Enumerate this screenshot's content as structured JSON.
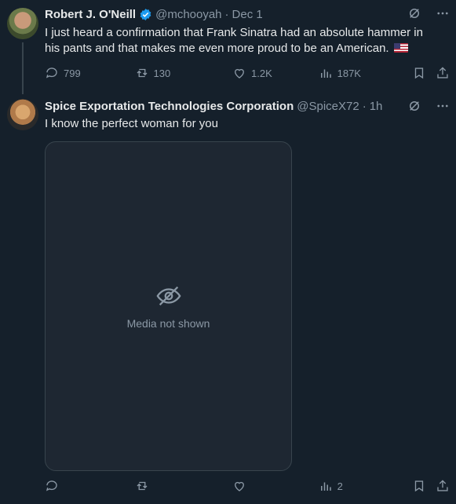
{
  "tweet1": {
    "name": "Robert J. O'Neill",
    "handle": "@mchooyah",
    "dot": "·",
    "time": "Dec 1",
    "text": "I just heard a confirmation that Frank Sinatra had an absolute hammer in his pants and that makes me even more proud to be an American.",
    "reply_count": "799",
    "retweet_count": "130",
    "like_count": "1.2K",
    "view_count": "187K"
  },
  "tweet2": {
    "name": "Spice Exportation Technologies Corporation",
    "handle": "@SpiceX72",
    "dot": "·",
    "time": "1h",
    "text": "I know the perfect woman for you",
    "media_placeholder": "Media not shown",
    "view_count": "2"
  },
  "colors": {
    "background": "#15202b",
    "text": "#e7e9ea",
    "muted": "#8b98a5",
    "verified": "#1d9bf0"
  }
}
